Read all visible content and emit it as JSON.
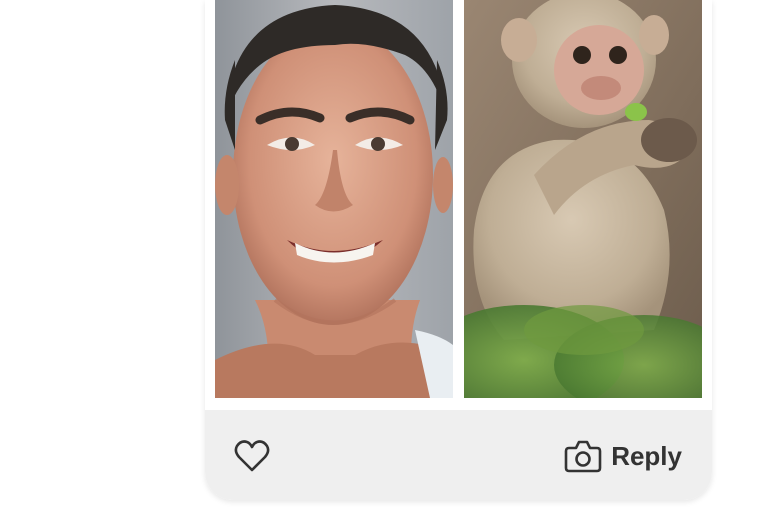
{
  "post": {
    "photos": [
      {
        "subject": "smiling-man-photo"
      },
      {
        "subject": "monkey-eating-photo"
      }
    ]
  },
  "footer": {
    "like_icon": "heart-outline-icon",
    "reply_icon": "camera-icon",
    "reply_label": "Reply",
    "footer_color": "#efefef",
    "icon_color": "#333333"
  }
}
